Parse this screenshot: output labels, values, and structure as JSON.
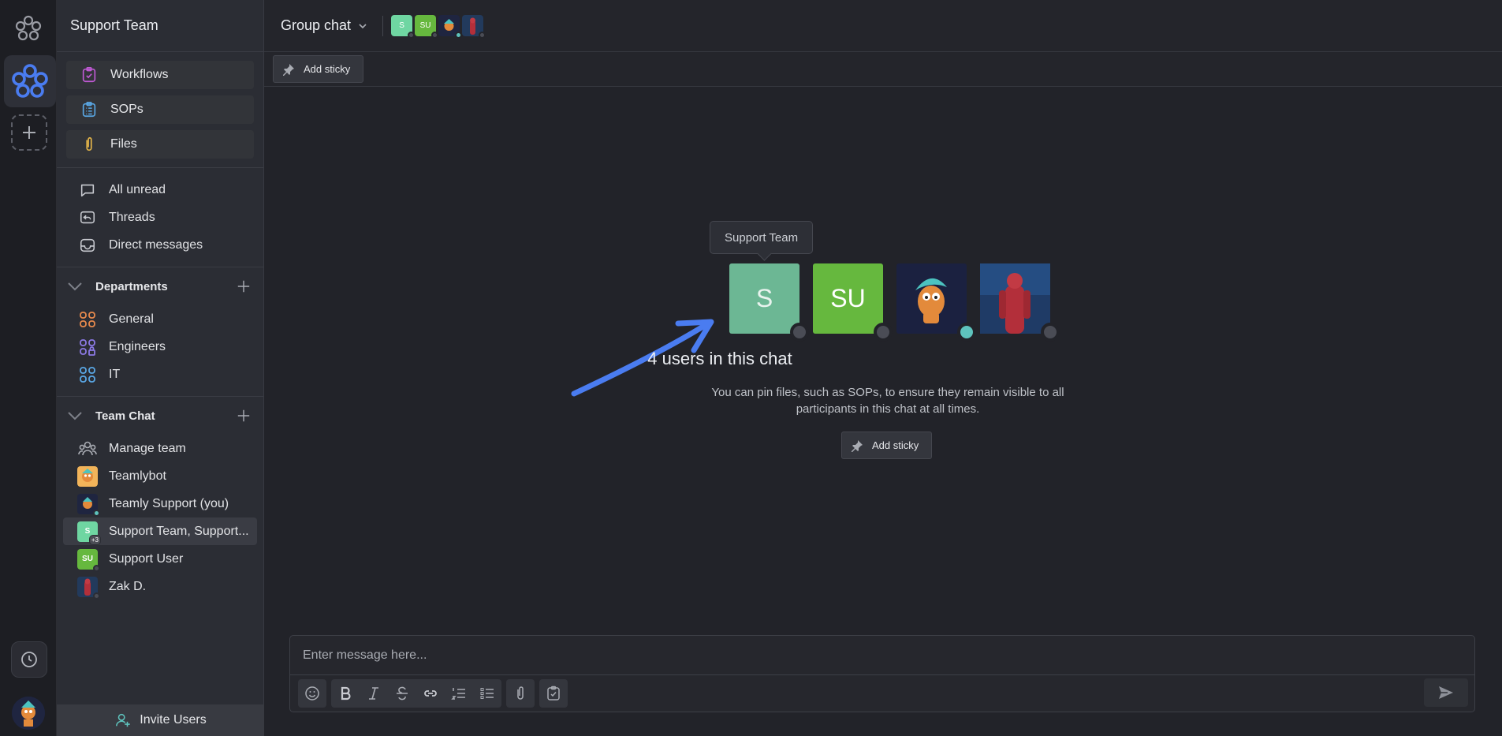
{
  "workspace": {
    "name": "Support Team"
  },
  "pinned": [
    {
      "label": "Workflows",
      "icon": "workflow-check-icon",
      "color": "#c15ad6"
    },
    {
      "label": "SOPs",
      "icon": "clipboard-list-icon",
      "color": "#5aa8e6"
    },
    {
      "label": "Files",
      "icon": "paperclip-icon",
      "color": "#e6b74a"
    }
  ],
  "nav": [
    {
      "label": "All unread",
      "icon": "chat-bubble-icon"
    },
    {
      "label": "Threads",
      "icon": "threads-icon"
    },
    {
      "label": "Direct messages",
      "icon": "inbox-icon"
    }
  ],
  "departments": {
    "title": "Departments",
    "items": [
      {
        "label": "General",
        "icon": "grid-icon",
        "color": "#e88a4d"
      },
      {
        "label": "Engineers",
        "icon": "grid-lock-icon",
        "color": "#8c7ae6"
      },
      {
        "label": "IT",
        "icon": "grid-icon",
        "color": "#5aa8e6"
      }
    ]
  },
  "team_chat": {
    "title": "Team Chat",
    "items": [
      {
        "label": "Manage team",
        "avatar": "people-icon"
      },
      {
        "label": "Teamlybot",
        "avatar": "bot"
      },
      {
        "label": "Teamly Support (you)",
        "avatar": "support"
      },
      {
        "label": "Support Team, Support...",
        "avatar_text": "S",
        "badge": "+3",
        "selected": true
      },
      {
        "label": "Support User",
        "avatar_text": "SU"
      },
      {
        "label": "Zak D.",
        "avatar": "zak"
      }
    ]
  },
  "invite": {
    "label": "Invite Users"
  },
  "header": {
    "title": "Group chat"
  },
  "mini_avatars": [
    {
      "text": "S",
      "color": "#6fd6a2",
      "online": false
    },
    {
      "text": "SU",
      "color": "#66b83e",
      "online": false
    },
    {
      "text": "",
      "color": "#1f2540",
      "online": true
    },
    {
      "text": "",
      "color": "#223a5c",
      "online": false
    }
  ],
  "sticky": {
    "label": "Add sticky"
  },
  "center": {
    "tooltip": "Support Team",
    "avatars": [
      {
        "text": "S",
        "color": "#6cb794",
        "online": false
      },
      {
        "text": "SU",
        "color": "#66b83e",
        "online": false
      },
      {
        "text": "",
        "color": "#1b2140",
        "online": true
      },
      {
        "text": "",
        "color": "#1f3b66",
        "online": false
      }
    ],
    "count_text": "4 users in this chat",
    "description": "You can pin files, such as SOPs, to ensure they remain visible to all participants in this chat at all times.",
    "sticky_label": "Add sticky"
  },
  "composer": {
    "placeholder": "Enter message here..."
  },
  "colors": {
    "accent": "#4a7cf0",
    "online": "#5ec3bd"
  }
}
